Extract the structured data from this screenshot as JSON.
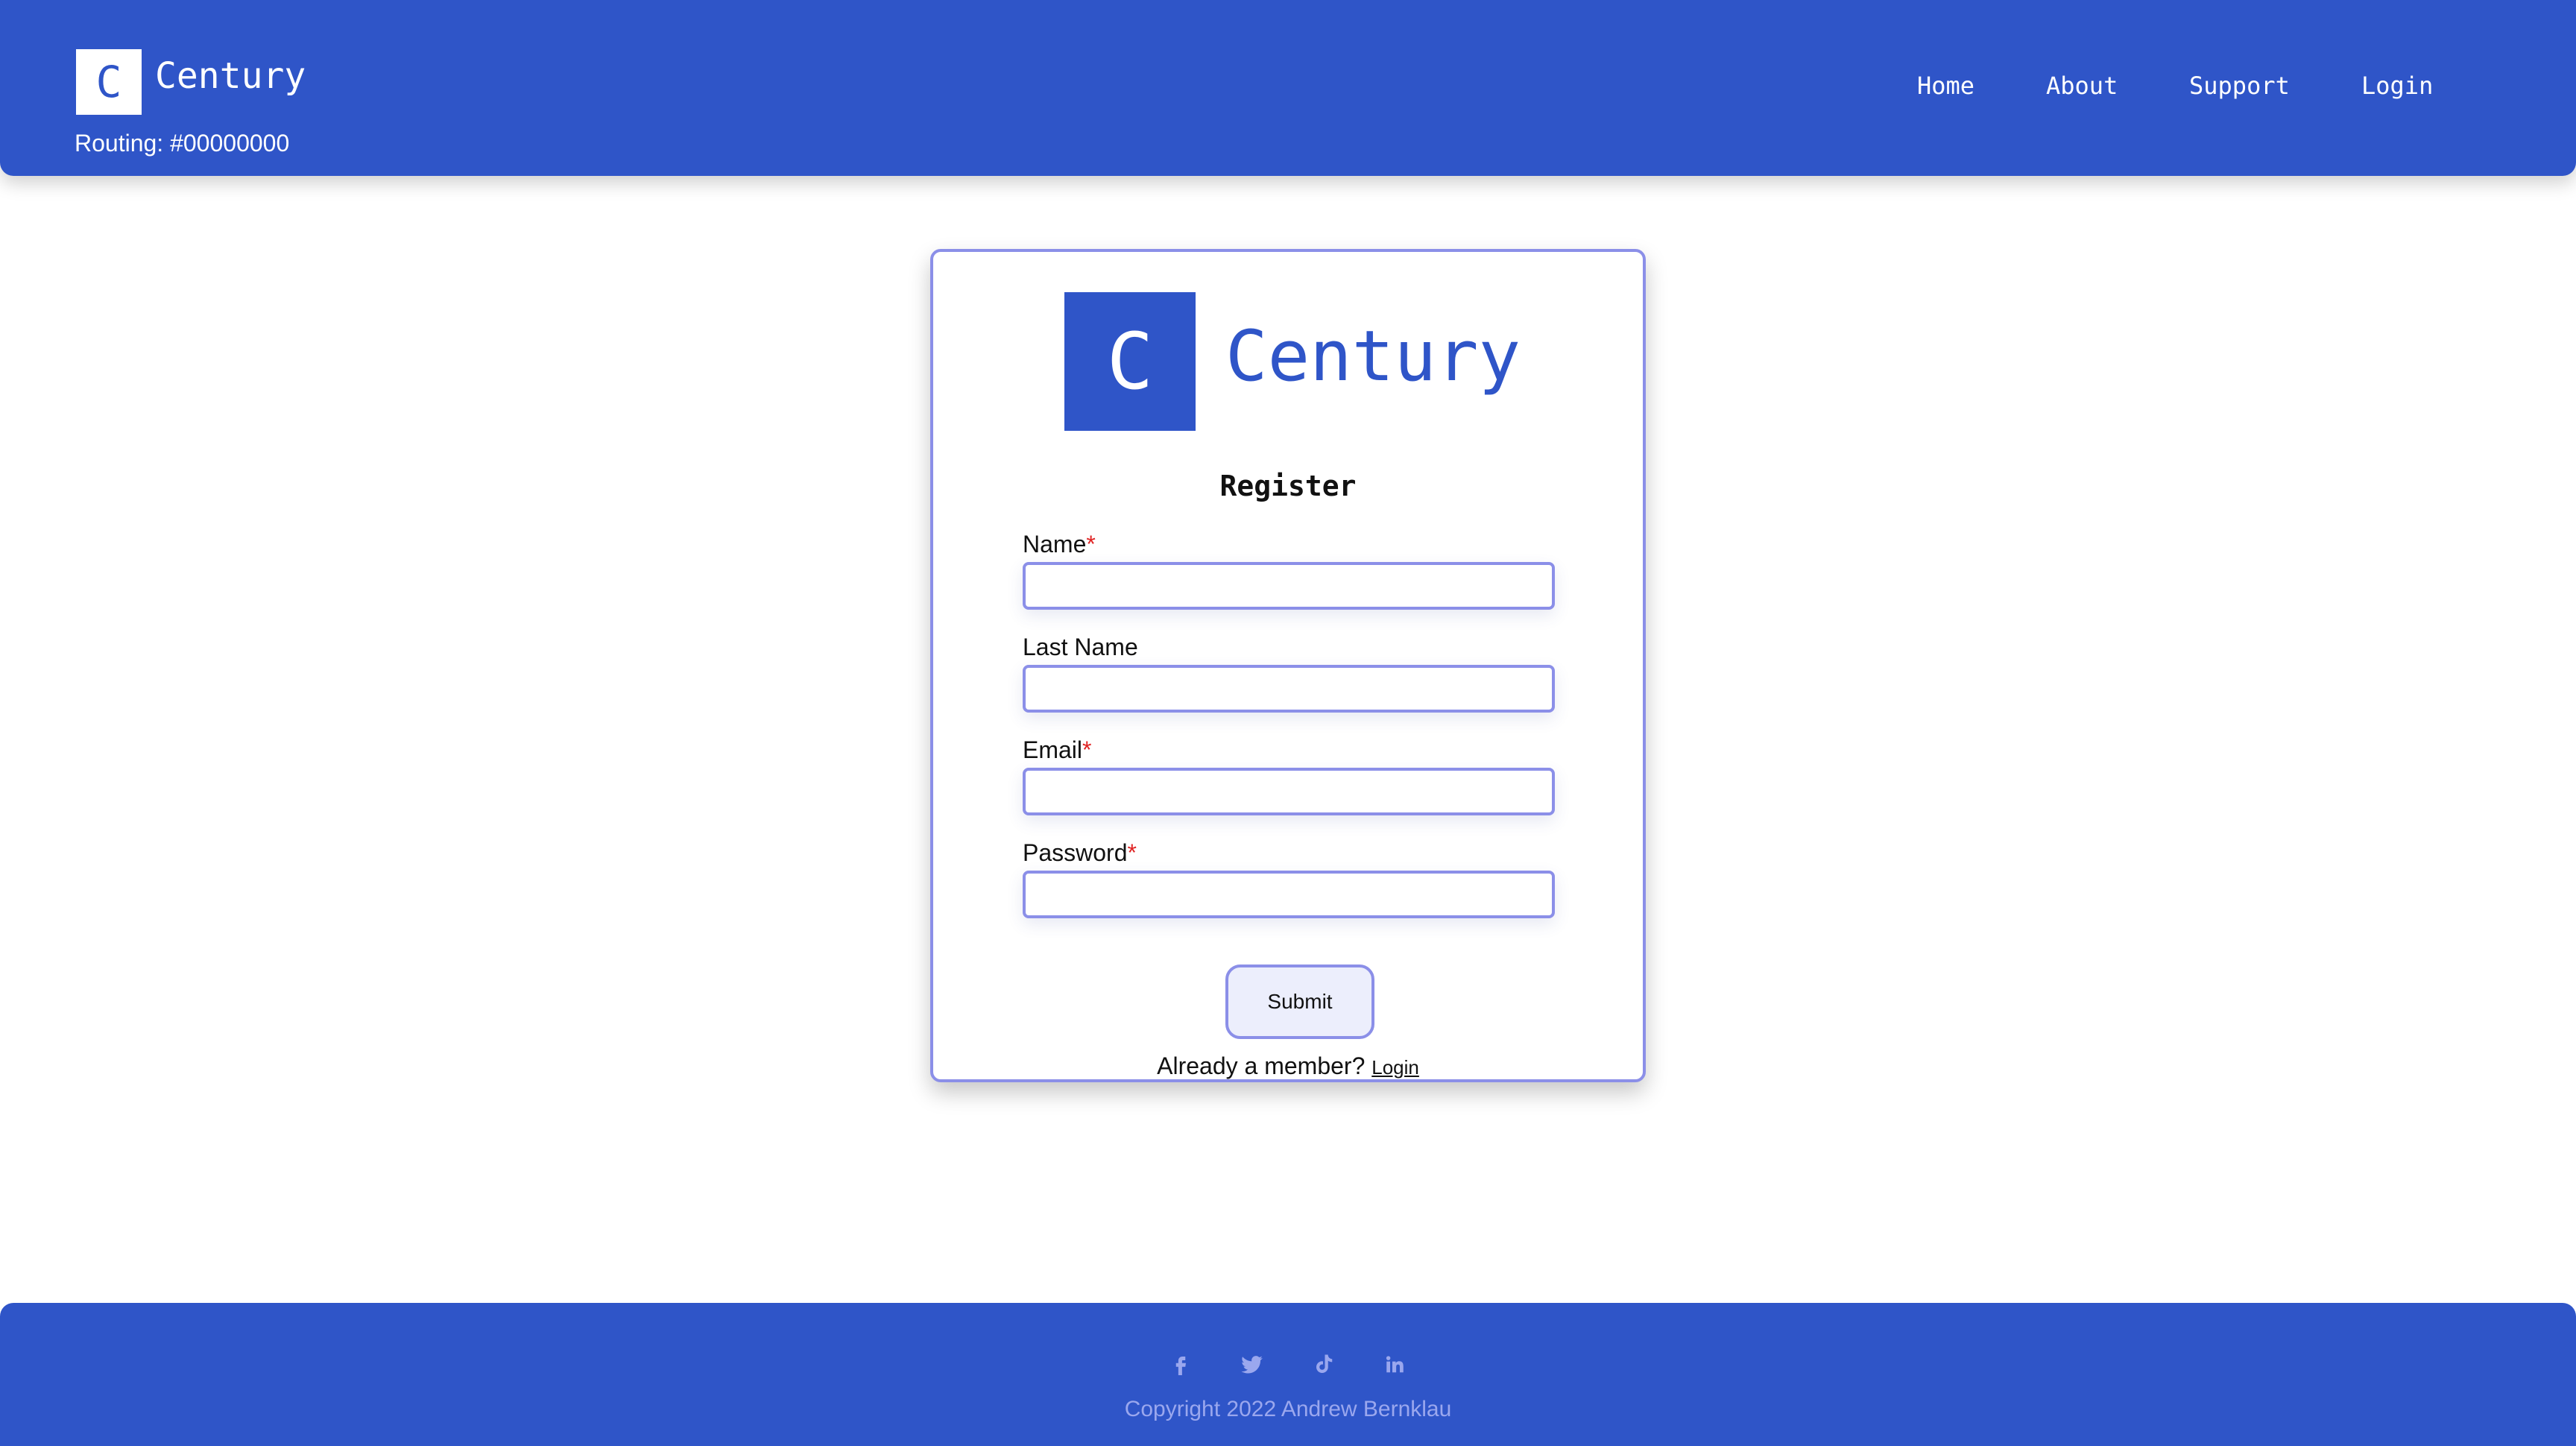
{
  "header": {
    "brand_letter": "C",
    "brand_name": "Century",
    "routing": "Routing: #00000000",
    "nav": {
      "home": "Home",
      "about": "About",
      "support": "Support",
      "login": "Login"
    }
  },
  "form": {
    "brand_letter": "C",
    "brand_name": "Century",
    "title": "Register",
    "fields": {
      "name": {
        "label": "Name",
        "required_mark": "*",
        "value": ""
      },
      "last_name": {
        "label": "Last Name",
        "value": ""
      },
      "email": {
        "label": "Email",
        "required_mark": "*",
        "value": ""
      },
      "password": {
        "label": "Password",
        "required_mark": "*",
        "value": ""
      }
    },
    "submit_label": "Submit",
    "member_text": "Already a member?",
    "login_link": "Login"
  },
  "footer": {
    "social_icons": [
      "facebook-icon",
      "twitter-icon",
      "tiktok-icon",
      "linkedin-icon"
    ],
    "copyright": "Copyright 2022 Andrew Bernklau"
  },
  "colors": {
    "primary": "#2f55c8",
    "input_border": "#8b8fe8",
    "required": "#e02424",
    "footer_text": "#9aa7ee"
  }
}
